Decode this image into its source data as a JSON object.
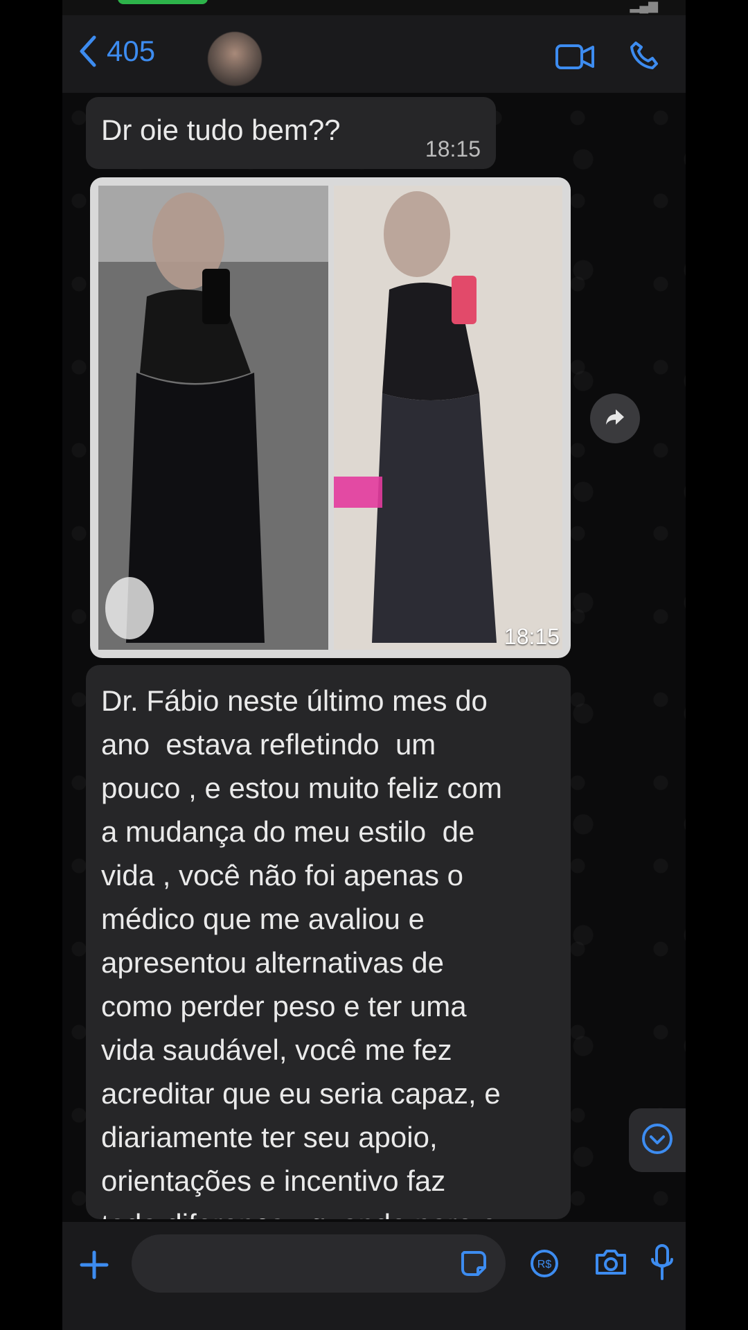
{
  "header": {
    "back_count": "405"
  },
  "messages": [
    {
      "text": "Dr oie tudo bem??",
      "time": "18:15"
    },
    {
      "type": "photo",
      "time": "18:15"
    },
    {
      "text": "Dr. Fábio neste último mes do\nano  estava refletindo  um\npouco , e estou muito feliz com\na mudança do meu estilo  de\nvida , você não foi apenas o\nmédico que me avaliou e\napresentou alternativas de\ncomo perder peso e ter uma\nvida saudável, você me fez\nacreditar que eu seria capaz, e\ndiariamente ter seu apoio,\norientações e incentivo faz\ntoda diferença , quando paro e"
    }
  ],
  "colors": {
    "accent": "#3d8cf0",
    "bubble": "#262628",
    "background": "#0b0b0c",
    "status_green": "#2db34a"
  },
  "icons": [
    "back-icon",
    "video-call-icon",
    "phone-call-icon",
    "forward-icon",
    "chevron-down-icon",
    "plus-icon",
    "sticker-icon",
    "pix-icon",
    "camera-icon",
    "mic-icon"
  ]
}
